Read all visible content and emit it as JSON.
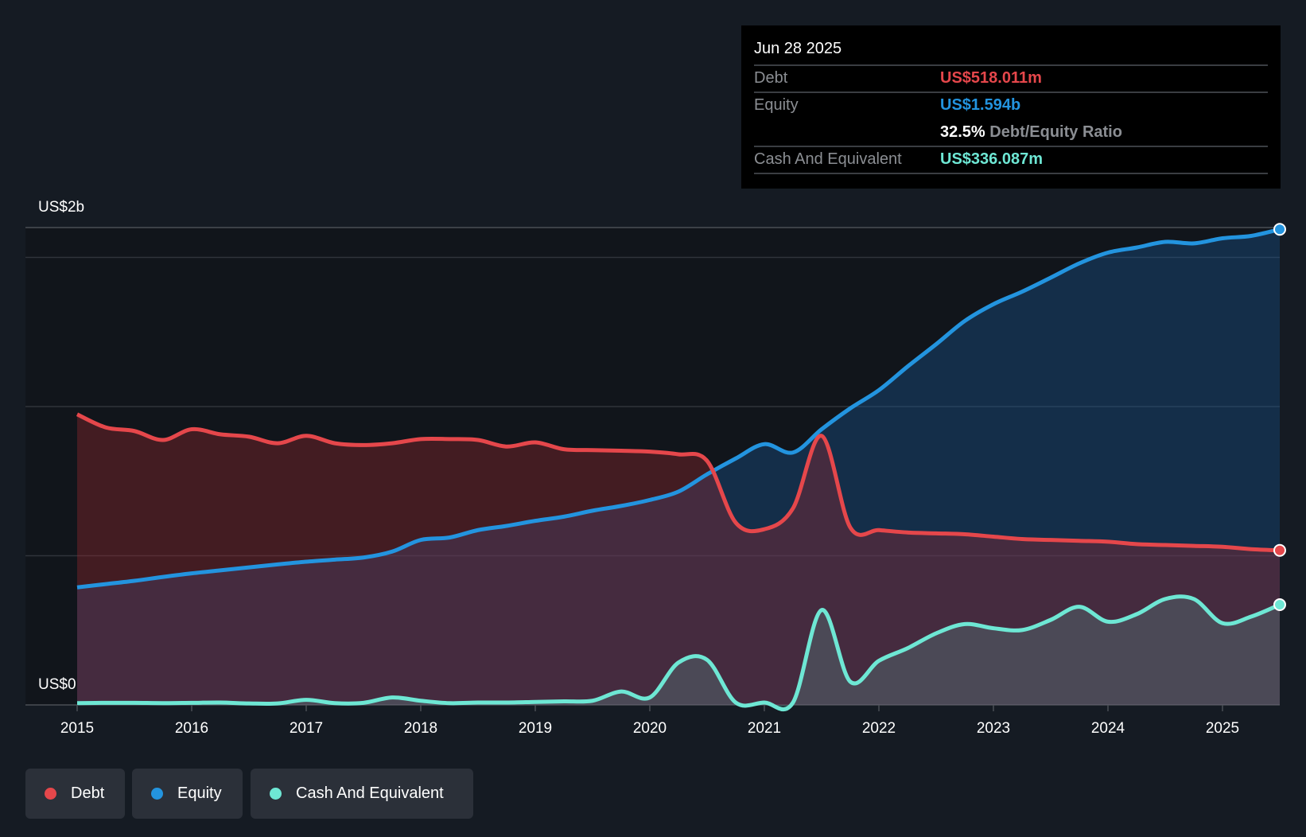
{
  "chart_data": {
    "type": "area",
    "y_axis_labels": {
      "top": "US$2b",
      "bottom": "US$0"
    },
    "ylim": [
      0,
      1.6
    ],
    "y_unit": "US$ billions",
    "gridlines": [
      0,
      0.5,
      1.0,
      1.5
    ],
    "xlim": [
      2015,
      2025.5
    ],
    "x_ticks": [
      "2015",
      "2016",
      "2017",
      "2018",
      "2019",
      "2020",
      "2021",
      "2022",
      "2023",
      "2024",
      "2025"
    ],
    "x": [
      2015,
      2015.25,
      2015.5,
      2015.75,
      2016,
      2016.25,
      2016.5,
      2016.75,
      2017,
      2017.25,
      2017.5,
      2017.75,
      2018,
      2018.25,
      2018.5,
      2018.75,
      2019,
      2019.25,
      2019.5,
      2019.75,
      2020,
      2020.25,
      2020.5,
      2020.75,
      2021,
      2021.25,
      2021.5,
      2021.75,
      2022,
      2022.25,
      2022.5,
      2022.75,
      2023,
      2023.25,
      2023.5,
      2023.75,
      2024,
      2024.25,
      2024.5,
      2024.75,
      2025,
      2025.25,
      2025.5
    ],
    "series": [
      {
        "name": "Debt",
        "color": "#e5474b",
        "values": [
          0.974,
          0.93,
          0.918,
          0.888,
          0.924,
          0.907,
          0.899,
          0.877,
          0.902,
          0.877,
          0.871,
          0.877,
          0.891,
          0.891,
          0.888,
          0.866,
          0.88,
          0.857,
          0.854,
          0.852,
          0.849,
          0.84,
          0.818,
          0.611,
          0.589,
          0.659,
          0.902,
          0.595,
          0.586,
          0.578,
          0.575,
          0.572,
          0.564,
          0.556,
          0.553,
          0.55,
          0.547,
          0.539,
          0.536,
          0.533,
          0.53,
          0.522,
          0.518
        ]
      },
      {
        "name": "Equity",
        "color": "#2394df",
        "values": [
          0.394,
          0.405,
          0.416,
          0.429,
          0.441,
          0.451,
          0.461,
          0.471,
          0.48,
          0.487,
          0.494,
          0.514,
          0.553,
          0.561,
          0.586,
          0.6,
          0.617,
          0.631,
          0.651,
          0.667,
          0.687,
          0.715,
          0.773,
          0.826,
          0.874,
          0.846,
          0.924,
          0.994,
          1.055,
          1.134,
          1.209,
          1.287,
          1.343,
          1.385,
          1.432,
          1.48,
          1.516,
          1.533,
          1.552,
          1.547,
          1.564,
          1.572,
          1.594
        ]
      },
      {
        "name": "Cash And Equivalent",
        "color": "#6ee7d4",
        "values": [
          0.006,
          0.007,
          0.007,
          0.006,
          0.007,
          0.008,
          0.005,
          0.005,
          0.017,
          0.006,
          0.007,
          0.025,
          0.014,
          0.006,
          0.008,
          0.008,
          0.01,
          0.012,
          0.014,
          0.045,
          0.025,
          0.142,
          0.151,
          0.008,
          0.008,
          0.008,
          0.318,
          0.078,
          0.148,
          0.19,
          0.24,
          0.271,
          0.257,
          0.251,
          0.285,
          0.329,
          0.279,
          0.304,
          0.355,
          0.355,
          0.274,
          0.296,
          0.336
        ]
      }
    ]
  },
  "tooltip": {
    "date": "Jun 28 2025",
    "debt_label": "Debt",
    "debt_value": "US$518.011m",
    "equity_label": "Equity",
    "equity_value": "US$1.594b",
    "ratio_value": "32.5%",
    "ratio_label": "Debt/Equity Ratio",
    "cash_label": "Cash And Equivalent",
    "cash_value": "US$336.087m"
  },
  "legend": [
    {
      "label": "Debt",
      "color": "#e5474b"
    },
    {
      "label": "Equity",
      "color": "#2394df"
    },
    {
      "label": "Cash And Equivalent",
      "color": "#6ee7d4"
    }
  ]
}
